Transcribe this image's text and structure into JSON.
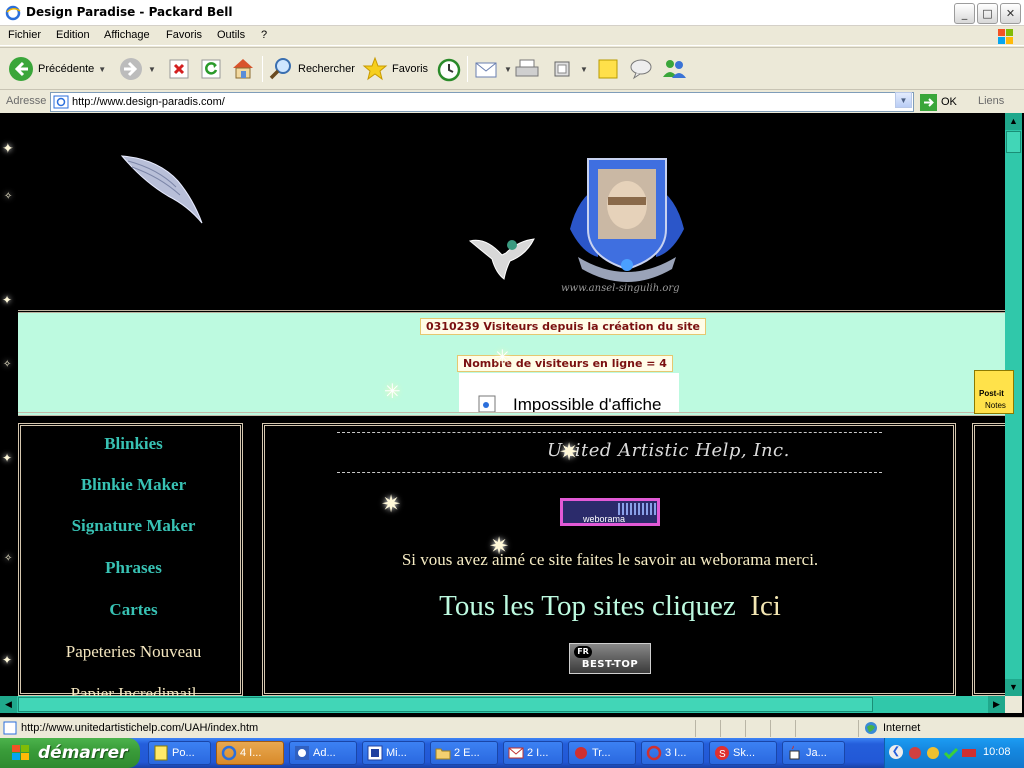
{
  "window": {
    "title": "Design Paradise - Packard Bell",
    "buttons": {
      "minimize": "_",
      "maximize": "□",
      "close": "✕"
    }
  },
  "menu": {
    "items": [
      "Fichier",
      "Edition",
      "Affichage",
      "Favoris",
      "Outils",
      "?"
    ]
  },
  "toolbar": {
    "back_label": "Précédente",
    "search_label": "Rechercher",
    "favorites_label": "Favoris"
  },
  "address": {
    "label": "Adresse",
    "url": "http://www.design-paradis.com/",
    "go_label": "OK",
    "links_label": "Liens"
  },
  "page": {
    "visitors_counter": "0310239 Visiteurs depuis la création du site",
    "online_counter": "Nombre de visiteurs en ligne = 4",
    "broken_frame_message": "Impossible d'affiche",
    "nav_links": [
      "Blinkies",
      "Blinkie Maker",
      "Signature Maker",
      "Phrases",
      "Cartes",
      "Papeteries Nouveau",
      "Papier Incredimail"
    ],
    "logo_text": "United Artistic Help, Inc.",
    "weborama_label": "weborama",
    "thanks_text": "Si vous avez aimé ce site faites le savoir au weborama merci.",
    "top_sites_text": "Tous les Top sites cliquez",
    "top_sites_link": "Ici",
    "best_top_badge": {
      "fr": "FR",
      "label": "BEST-TOP"
    },
    "postit": {
      "line1": "Post-it",
      "line2": "Notes"
    },
    "crest_caption": "www.ansel-singulih.org"
  },
  "status": {
    "url": "http://www.unitedartistichelp.com/UAH/index.htm",
    "zone": "Internet"
  },
  "taskbar": {
    "start_label": "démarrer",
    "tasks": [
      {
        "label": "Po...",
        "icon": "notepad-icon",
        "active": false
      },
      {
        "label": "4 I...",
        "icon": "ie-icon",
        "active": true
      },
      {
        "label": "Ad...",
        "icon": "ad-icon",
        "active": false
      },
      {
        "label": "Mi...",
        "icon": "app-icon",
        "active": false
      },
      {
        "label": "2 E...",
        "icon": "folder-icon",
        "active": false
      },
      {
        "label": "2 I...",
        "icon": "mail-icon",
        "active": false
      },
      {
        "label": "Tr...",
        "icon": "tr-icon",
        "active": false
      },
      {
        "label": "3 I...",
        "icon": "ie-icon",
        "active": false
      },
      {
        "label": "Sk...",
        "icon": "skype-icon",
        "active": false
      },
      {
        "label": "Ja...",
        "icon": "java-icon",
        "active": false
      }
    ],
    "clock": "10:08"
  },
  "colors": {
    "page_mint": "#bdfae0",
    "nav_teal": "#38c2b4",
    "scrollbar": "#30c8aa",
    "taskbar_blue": "#245edb"
  }
}
